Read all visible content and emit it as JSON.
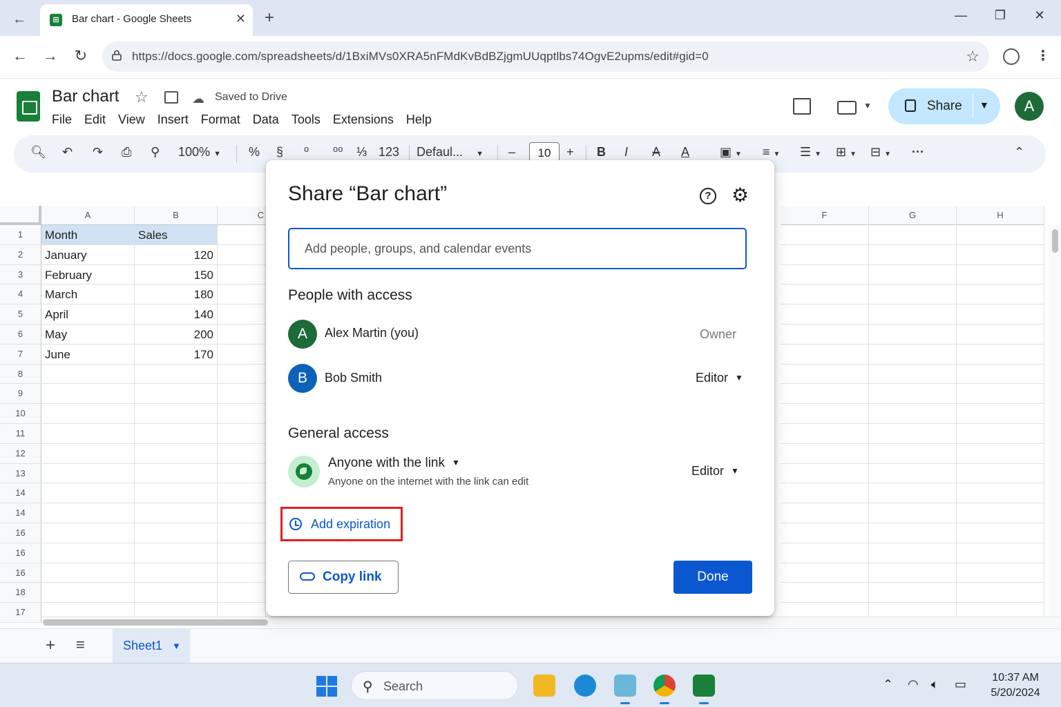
{
  "browser": {
    "tab_title": "Bar chart - Google Sheets",
    "url": "https://docs.google.com/spreadsheets/d/1BxiMVs0XRA5nFMdKvBdBZjgmUUqptlbs74OgvE2upms/edit#gid=0"
  },
  "sheets": {
    "doc_title": "Bar chart",
    "save_status": "Saved to Drive",
    "menus": [
      "File",
      "Edit",
      "View",
      "Insert",
      "Format",
      "Data",
      "Tools",
      "Extensions",
      "Help"
    ],
    "share_label": "Share",
    "avatar_letter": "A",
    "toolbar": {
      "zoom": "100%",
      "percent": "%",
      "format_123": "123",
      "font": "Defaul...",
      "font_size": "10",
      "minus": "–",
      "plus": "+",
      "bold": "B",
      "italic": "I",
      "text_color": "A"
    },
    "columns": [
      "A",
      "B",
      "C",
      "F",
      "G",
      "H"
    ],
    "row_numbers": [
      "1",
      "2",
      "3",
      "4",
      "5",
      "6",
      "7",
      "8",
      "9",
      "10",
      "11",
      "12",
      "13",
      "14",
      "14",
      "16",
      "16",
      "16",
      "18",
      "17"
    ],
    "table": {
      "header": [
        "Month",
        "Sales"
      ],
      "rows": [
        [
          "January",
          "120"
        ],
        [
          "February",
          "150"
        ],
        [
          "March",
          "180"
        ],
        [
          "April",
          "140"
        ],
        [
          "May",
          "200"
        ],
        [
          "June",
          "170"
        ]
      ]
    },
    "sheet_tab": "Sheet1"
  },
  "dialog": {
    "title": "Share “Bar chart”",
    "add_people_placeholder": "Add people, groups, and calendar events",
    "people_heading": "People with access",
    "people": [
      {
        "initial": "A",
        "name": "Alex Martin (you)",
        "role": "Owner",
        "color": "#1e6b3a"
      },
      {
        "initial": "B",
        "name": "Bob Smith",
        "role": "Editor",
        "color": "#0b62b8"
      }
    ],
    "general_heading": "General access",
    "access_scope": "Anyone with the link",
    "access_desc": "Anyone on the internet with the link can edit",
    "access_role": "Editor",
    "add_expiration": "Add expiration",
    "copy_link": "Copy link",
    "done": "Done"
  },
  "taskbar": {
    "search_label": "Search",
    "time": "10:37 AM",
    "date": "5/20/2024"
  },
  "colors": {
    "accent": "#0b57d0",
    "share_bg": "#c2e7ff",
    "highlight": "#e02020"
  }
}
